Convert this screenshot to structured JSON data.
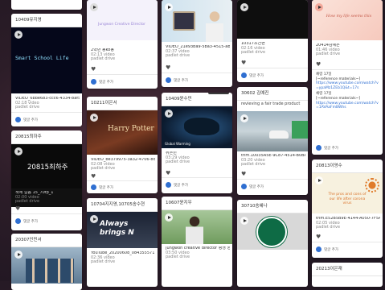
{
  "common": {
    "type_video": "video",
    "author": "padlet drive",
    "comment_add": "댓글 추가"
  },
  "col1": {
    "card_a_title": "10409유지영",
    "card_a_media_text": "Smart School Life",
    "card_a_file": "VIDEO_6bbe683-ccc6-4334-8af5-bb...",
    "card_a_duration": "02:18 video",
    "card_b_title": "20815최하주",
    "card_b_media_text": "20815최하주",
    "card_b_file": "책에 걸음 15_70fp_1",
    "card_b_duration": "02:00 video",
    "card_c_title": "20307인민서"
  },
  "col2": {
    "card_a_media_text": "Jungwon Creative Director",
    "card_a_file": "2학년 동ko동",
    "card_a_duration": "02:13 video",
    "card_b_title": "10211이은서",
    "card_b_media_text": "Harry Potter",
    "card_b_file": "VIDEO_be379975-3a32-4706-8dee-8c...",
    "card_b_duration": "02:08 video",
    "card_c_title": "10704지지영,10705송수현",
    "card_c_media_text": "Always brings N",
    "card_c_file": "YouTube_20200608_084355571",
    "card_c_duration": "02:36 video"
  },
  "col3": {
    "card_a_file": "VIDEO_21e93ba9-5ba3-4515-abdf-8...",
    "card_a_duration": "02:37 video",
    "card_b_title": "10409윤수민",
    "card_b_media_text": "Global Warming",
    "card_b_file": "취흔빈",
    "card_b_duration": "03:29 video",
    "card_c_title": "10607윤지우",
    "card_c_file": "Jungwon creative director 평생 영상",
    "card_c_duration": "03:50 video"
  },
  "col4": {
    "card_a_file": "10317조건현",
    "card_a_duration": "02:16 video",
    "card_b_title": "30602 김예진",
    "card_b_subtitle": "revieving a fair trade product",
    "card_b_file": "trim.10035A5E-9C87-4514-B0BA-85...",
    "card_b_duration": "03:20 video",
    "card_c_title": "30710송혜나"
  },
  "col5": {
    "card_a_media_text": "How my life seems this",
    "card_a_file": "20414김예은",
    "card_a_duration": "01:46 video",
    "comment_1": "채령 17일",
    "comment_1_body": "[~reference materials~]",
    "comment_1_link": "https://www.youtube.com/watch?v=ypaMz1ZEb1Q&t=17s",
    "comment_2": "채령 17일",
    "comment_2_body": "[~reference materials~]",
    "comment_2_link": "https://www.youtube.com/watch?v=1AVAaFmBWhs",
    "card_b_title": "20813이영수",
    "card_b_media_text": "The pros and cons of our life after corona virus",
    "card_b_file": "trim.E52B5B9E-4144-A050-7F5A-7F3...",
    "card_b_duration": "02:05 video",
    "card_c_title": "20213이은재"
  }
}
